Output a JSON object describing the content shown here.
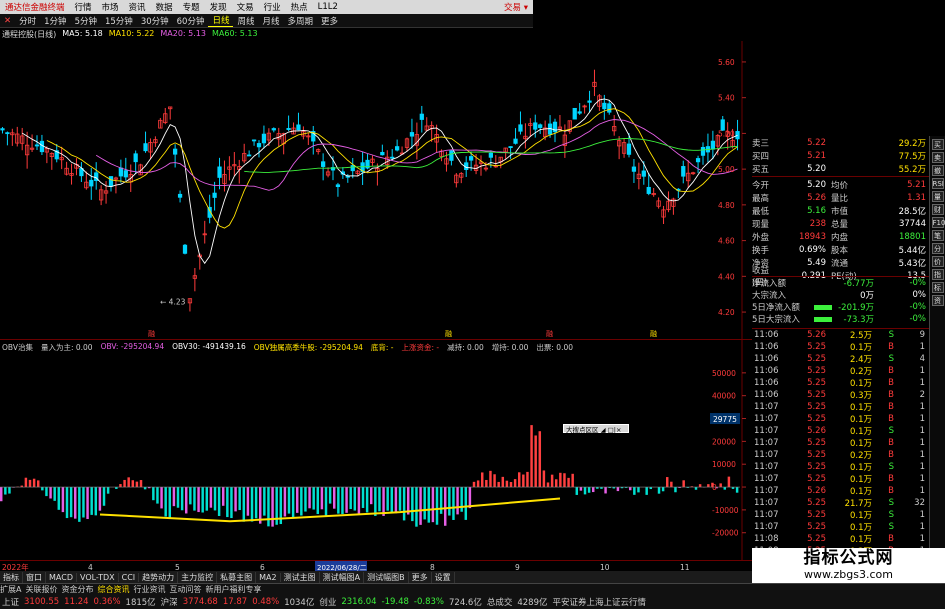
{
  "menubar": {
    "app_title": "通达信金融终端",
    "items": [
      "行情",
      "市场",
      "资讯",
      "数据",
      "专题",
      "发现",
      "文易",
      "行业",
      "热点",
      "L1L2"
    ],
    "right_label": "交易 ▾"
  },
  "periodbar": {
    "items": [
      {
        "label": "分时",
        "active": false
      },
      {
        "label": "1分钟",
        "active": false
      },
      {
        "label": "5分钟",
        "active": false
      },
      {
        "label": "15分钟",
        "active": false
      },
      {
        "label": "30分钟",
        "active": false
      },
      {
        "label": "60分钟",
        "active": false
      },
      {
        "label": "日线",
        "active": true
      },
      {
        "label": "周线",
        "active": false
      },
      {
        "label": "月线",
        "active": false
      },
      {
        "label": "多周期",
        "active": false
      },
      {
        "label": "更多",
        "active": false
      }
    ]
  },
  "ma_legend": [
    {
      "label": "通程控股(日线)",
      "color": "#dddddd"
    },
    {
      "label": "MA5: 5.18",
      "color": "#ffffff"
    },
    {
      "label": "MA10: 5.22",
      "color": "#ffe100"
    },
    {
      "label": "MA20: 5.13",
      "color": "#e55fe5"
    },
    {
      "label": "MA60: 5.13",
      "color": "#3cf03c"
    }
  ],
  "price_axis": [
    "5.60",
    "5.40",
    "5.20",
    "5.00",
    "4.80",
    "4.60",
    "4.40",
    "4.20"
  ],
  "low_price_label": "4.23",
  "event_labels": [
    "融",
    "融",
    "融",
    "融"
  ],
  "ind_legend": [
    {
      "label": "OBV治集",
      "color": "#cccccc"
    },
    {
      "label": "量入为主: 0.00",
      "color": "#cccccc"
    },
    {
      "label": "OBV: -295204.94",
      "color": "#e55fe5"
    },
    {
      "label": "OBV30: -491439.16",
      "color": "#ffffff"
    },
    {
      "label": "OBV独属高季牛股: -295204.94",
      "color": "#ffe100"
    },
    {
      "label": "底背: -",
      "color": "#ffe100"
    },
    {
      "label": "上涨资金: -",
      "color": "#ff3b3b"
    },
    {
      "label": "减持: 0.00",
      "color": "#cccccc"
    },
    {
      "label": "增持: 0.00",
      "color": "#cccccc"
    },
    {
      "label": "出票: 0.00",
      "color": "#cccccc"
    }
  ],
  "ind_axis": [
    "50000",
    "40000",
    "30000",
    "20000",
    "10000",
    "0",
    "-10000",
    "-20000"
  ],
  "ind_current": "29775",
  "popup_label": "大搜点区区 ◢ □|×",
  "date_bar": {
    "left": "2022年",
    "months": [
      "4",
      "5",
      "6",
      "7",
      "8",
      "9",
      "10",
      "11"
    ],
    "highlight": "2022/06/28/二"
  },
  "tabs": [
    {
      "label": "指标",
      "active": false
    },
    {
      "label": "窗口",
      "active": false
    },
    {
      "label": "MACD",
      "active": false
    },
    {
      "label": "VOL-TDX",
      "active": false
    },
    {
      "label": "CCI",
      "active": false
    },
    {
      "label": "趋势动力",
      "active": false
    },
    {
      "label": "主力监控",
      "active": false
    },
    {
      "label": "私募主图",
      "active": false
    },
    {
      "label": "MA2",
      "active": false
    },
    {
      "label": "测试主图",
      "active": false
    },
    {
      "label": "测试幅图A",
      "active": false
    },
    {
      "label": "测试幅图B",
      "active": false
    },
    {
      "label": "更多",
      "active": false
    },
    {
      "label": "设置",
      "active": false
    }
  ],
  "status_items": [
    {
      "label": "扩展A",
      "color": "#ccc"
    },
    {
      "label": "关联报价",
      "color": "#ccc"
    },
    {
      "label": "资金分布",
      "color": "#ccc"
    },
    {
      "label": "综合资讯",
      "color": "#ffe100"
    },
    {
      "label": "行业资讯",
      "color": "#ccc"
    },
    {
      "label": "互动问答",
      "color": "#ccc"
    },
    {
      "label": "新用户福利专享",
      "color": "#ccc"
    }
  ],
  "quote": {
    "top_rows": [
      {
        "l": "卖三",
        "v": "5.22",
        "v2": "29.2万",
        "vc": "red"
      },
      {
        "l": "买四",
        "v": "5.21",
        "v2": "77.5万",
        "vc": "red"
      },
      {
        "l": "买五",
        "v": "5.20",
        "v2": "55.2万",
        "vc": "wht"
      }
    ],
    "rows": [
      {
        "l": "今开",
        "v": "5.20",
        "vc": "wht",
        "l2": "均价",
        "v2": "5.21",
        "v2c": "red"
      },
      {
        "l": "最高",
        "v": "5.26",
        "vc": "red",
        "l2": "量比",
        "v2": "1.31",
        "v2c": "red"
      },
      {
        "l": "最低",
        "v": "5.16",
        "vc": "grn",
        "l2": "市值",
        "v2": "28.5亿",
        "v2c": "wht"
      },
      {
        "l": "现量",
        "v": "238",
        "vc": "red",
        "l2": "总量",
        "v2": "37744",
        "v2c": "wht"
      },
      {
        "l": "外盘",
        "v": "18943",
        "vc": "red",
        "l2": "内盘",
        "v2": "18801",
        "v2c": "grn"
      },
      {
        "l": "换手",
        "v": "0.69%",
        "vc": "wht",
        "l2": "股本",
        "v2": "5.44亿",
        "v2c": "wht"
      },
      {
        "l": "净资",
        "v": "5.49",
        "vc": "wht",
        "l2": "流通",
        "v2": "5.43亿",
        "v2c": "wht"
      },
      {
        "l": "收益(四)",
        "v": "0.291",
        "vc": "wht",
        "l2": "PE(动)",
        "v2": "13.5",
        "v2c": "wht"
      }
    ]
  },
  "flow": [
    {
      "l": "净流入额",
      "bar": false,
      "v": "-6.77万",
      "vc": "grn",
      "p": "-0%",
      "pc": "grn"
    },
    {
      "l": "大宗流入",
      "bar": false,
      "v": "0万",
      "vc": "wht",
      "p": "0%",
      "pc": "wht"
    },
    {
      "l": "5日净流入额",
      "bar": true,
      "v": "-201.9万",
      "vc": "grn",
      "p": "-0%",
      "pc": "grn"
    },
    {
      "l": "5日大宗流入",
      "bar": true,
      "v": "-73.3万",
      "vc": "grn",
      "p": "-0%",
      "pc": "grn"
    }
  ],
  "ticks": [
    {
      "t": "11:06",
      "p": "5.26",
      "vol": "2.5万",
      "bs": "S",
      "bc": "grn",
      "n": "9"
    },
    {
      "t": "11:06",
      "p": "5.25",
      "vol": "0.1万",
      "bs": "B",
      "bc": "red",
      "n": "1"
    },
    {
      "t": "11:06",
      "p": "5.25",
      "vol": "2.4万",
      "bs": "S",
      "bc": "grn",
      "n": "4"
    },
    {
      "t": "11:06",
      "p": "5.25",
      "vol": "0.2万",
      "bs": "B",
      "bc": "red",
      "n": "1"
    },
    {
      "t": "11:06",
      "p": "5.25",
      "vol": "0.1万",
      "bs": "B",
      "bc": "red",
      "n": "1"
    },
    {
      "t": "11:06",
      "p": "5.25",
      "vol": "0.3万",
      "bs": "B",
      "bc": "red",
      "n": "2"
    },
    {
      "t": "11:07",
      "p": "5.25",
      "vol": "0.1万",
      "bs": "B",
      "bc": "red",
      "n": "1"
    },
    {
      "t": "11:07",
      "p": "5.25",
      "vol": "0.1万",
      "bs": "B",
      "bc": "red",
      "n": "1"
    },
    {
      "t": "11:07",
      "p": "5.26",
      "vol": "0.1万",
      "bs": "S",
      "bc": "grn",
      "n": "1"
    },
    {
      "t": "11:07",
      "p": "5.25",
      "vol": "0.1万",
      "bs": "B",
      "bc": "red",
      "n": "1"
    },
    {
      "t": "11:07",
      "p": "5.25",
      "vol": "0.2万",
      "bs": "B",
      "bc": "red",
      "n": "1"
    },
    {
      "t": "11:07",
      "p": "5.25",
      "vol": "0.1万",
      "bs": "S",
      "bc": "grn",
      "n": "1"
    },
    {
      "t": "11:07",
      "p": "5.25",
      "vol": "0.1万",
      "bs": "B",
      "bc": "red",
      "n": "1"
    },
    {
      "t": "11:07",
      "p": "5.26",
      "vol": "0.1万",
      "bs": "B",
      "bc": "red",
      "n": "1"
    },
    {
      "t": "11:07",
      "p": "5.25",
      "vol": "21.7万",
      "bs": "S",
      "bc": "grn",
      "n": "32"
    },
    {
      "t": "11:07",
      "p": "5.25",
      "vol": "0.1万",
      "bs": "S",
      "bc": "grn",
      "n": "1"
    },
    {
      "t": "11:07",
      "p": "5.25",
      "vol": "0.1万",
      "bs": "S",
      "bc": "grn",
      "n": "1"
    },
    {
      "t": "11:08",
      "p": "5.25",
      "vol": "0.1万",
      "bs": "B",
      "bc": "red",
      "n": "1"
    },
    {
      "t": "11:08",
      "p": "5.25",
      "vol": "0.2万",
      "bs": "B",
      "bc": "red",
      "n": "1"
    },
    {
      "t": "11:08",
      "p": "5.25",
      "vol": "0.1万",
      "bs": "S",
      "bc": "grn",
      "n": "1"
    },
    {
      "t": "11:08",
      "p": "5.25",
      "vol": "0.1万",
      "bs": "B",
      "bc": "red",
      "n": "1"
    }
  ],
  "sidebar": [
    "买",
    "卖",
    "撤",
    "RSI",
    "量",
    "财",
    "F10",
    "笔",
    "分",
    "价",
    "指",
    "标",
    "资"
  ],
  "bottom": [
    {
      "label": "上证",
      "color": "#ccc"
    },
    {
      "label": "3100.55",
      "color": "#ff3b3b"
    },
    {
      "label": "11.24",
      "color": "#ff3b3b"
    },
    {
      "label": "0.36%",
      "color": "#ff3b3b"
    },
    {
      "label": "1815亿",
      "color": "#ccc"
    },
    {
      "label": "沪深",
      "color": "#ccc"
    },
    {
      "label": "3774.68",
      "color": "#ff3b3b"
    },
    {
      "label": "17.87",
      "color": "#ff3b3b"
    },
    {
      "label": "0.48%",
      "color": "#ff3b3b"
    },
    {
      "label": "1034亿",
      "color": "#ccc"
    },
    {
      "label": "创业",
      "color": "#ccc"
    },
    {
      "label": "2316.04",
      "color": "#3cf03c"
    },
    {
      "label": "-19.48",
      "color": "#3cf03c"
    },
    {
      "label": "-0.83%",
      "color": "#3cf03c"
    },
    {
      "label": "724.6亿",
      "color": "#ccc"
    },
    {
      "label": "总成交",
      "color": "#ccc"
    },
    {
      "label": "4289亿",
      "color": "#ccc"
    },
    {
      "label": "平安证券上海上证云行情",
      "color": "#ccc"
    }
  ],
  "watermark": {
    "title": "指标公式网",
    "url": "www.zbgs3.com"
  },
  "colors": {
    "up": "#ff3b3b",
    "down": "#00d5ff",
    "ma5": "#ffffff",
    "ma10": "#ffe100",
    "ma20": "#e55fe5",
    "ma60": "#3cf03c",
    "obv_pos": "#ff4040",
    "obv_neg": "#00e0d0"
  }
}
